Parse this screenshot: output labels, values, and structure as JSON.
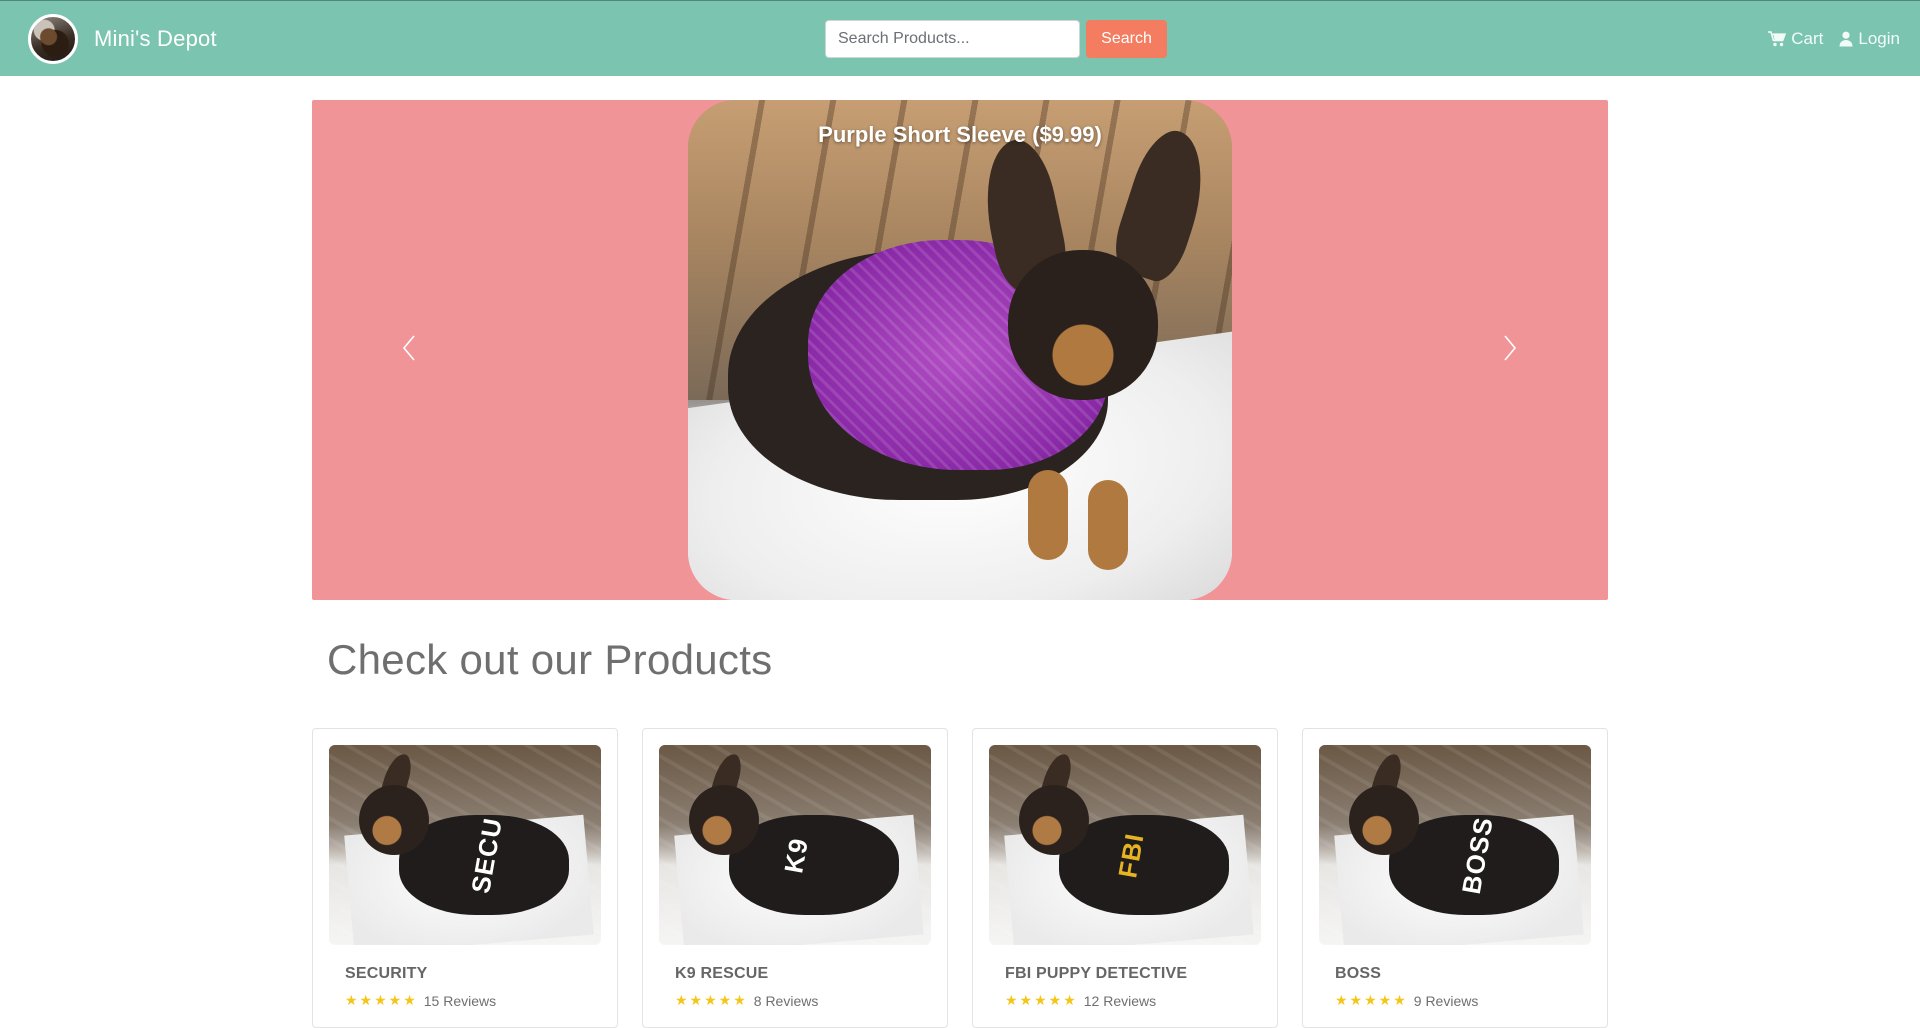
{
  "navbar": {
    "brand_name": "Mini's Depot",
    "search_placeholder": "Search Products...",
    "search_button": "Search",
    "cart_label": "Cart",
    "login_label": "Login"
  },
  "carousel": {
    "caption": "Purple Short Sleeve ($9.99)"
  },
  "products_section": {
    "title": "Check out our Products",
    "items": [
      {
        "name": "SECURITY",
        "print": "SECU",
        "reviews": "15 Reviews",
        "stars": "★★★★★"
      },
      {
        "name": "K9 RESCUE",
        "print": "K9",
        "reviews": "8 Reviews",
        "stars": "★★★★★"
      },
      {
        "name": "FBI PUPPY DETECTIVE",
        "print": "FBI",
        "reviews": "12 Reviews",
        "stars": "★★★★★"
      },
      {
        "name": "BOSS",
        "print": "BOSS",
        "reviews": "9 Reviews",
        "stars": "★★★★★"
      }
    ]
  },
  "colors": {
    "navbar": "#7ac4b0",
    "search_button": "#f47c61",
    "carousel_bg": "#f19498",
    "star": "#f5c518"
  },
  "icons": {
    "cart": "shopping-cart-icon",
    "login": "user-icon",
    "prev": "chevron-left-icon",
    "next": "chevron-right-icon"
  }
}
